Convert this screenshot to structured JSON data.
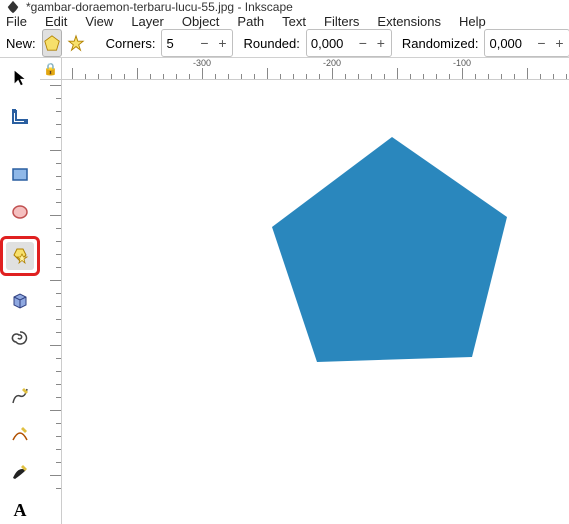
{
  "title": "*gambar-doraemon-terbaru-lucu-55.jpg - Inkscape",
  "menu": {
    "file": "File",
    "edit": "Edit",
    "view": "View",
    "layer": "Layer",
    "object": "Object",
    "path": "Path",
    "text": "Text",
    "filters": "Filters",
    "extensions": "Extensions",
    "help": "Help"
  },
  "toolbar": {
    "new_label": "New:",
    "corners_label": "Corners:",
    "corners_value": "5",
    "rounded_label": "Rounded:",
    "rounded_value": "0,000",
    "randomized_label": "Randomized:",
    "randomized_value": "0,000",
    "minus": "−",
    "plus": "+"
  },
  "ruler": {
    "m300": "-300",
    "m200": "-200",
    "m100": "-100"
  },
  "shape": {
    "fill": "#2a87bd"
  },
  "chart_data": null
}
